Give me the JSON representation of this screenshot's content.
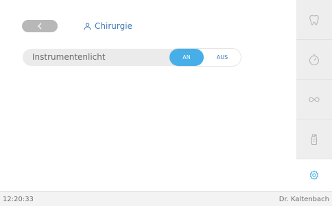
{
  "header": {
    "back_icon": "chevron-left-icon",
    "profile_icon": "person-icon",
    "profile_label": "Chirurgie"
  },
  "settings": {
    "instrument_light_label": "Instrumentenlicht",
    "toggle_on_label": "AN",
    "toggle_off_label": "AUS",
    "selected": "AN"
  },
  "sidebar": {
    "items": [
      {
        "icon": "tooth-icon"
      },
      {
        "icon": "timer-icon"
      },
      {
        "icon": "link-icon"
      },
      {
        "icon": "spray-bottle-icon"
      },
      {
        "icon": "gear-icon",
        "active": true
      }
    ]
  },
  "statusbar": {
    "time": "12:20:33",
    "user": "Dr. Kaltenbach"
  },
  "colors": {
    "accent": "#47aee8",
    "link": "#3f78b6",
    "sidebar_bg": "#eeeeee"
  }
}
